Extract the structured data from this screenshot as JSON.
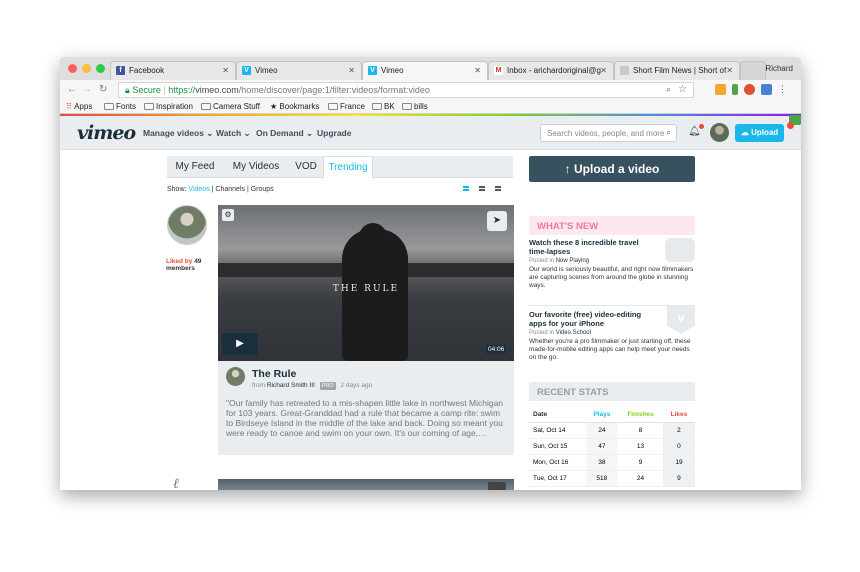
{
  "browser": {
    "tabs": [
      {
        "label": "Facebook",
        "favicon": "facebook-icon",
        "color": "#3b5998",
        "glyph": "f"
      },
      {
        "label": "Vimeo",
        "favicon": "vimeo-icon",
        "color": "#1ab7ea",
        "glyph": "V"
      },
      {
        "label": "Vimeo",
        "favicon": "vimeo-icon",
        "color": "#1ab7ea",
        "glyph": "V"
      },
      {
        "label": "Inbox - arichardoriginal@g",
        "favicon": "gmail-icon",
        "color": "#d93025",
        "glyph": "M"
      },
      {
        "label": "Short Film News | Short of",
        "favicon": "page-icon",
        "color": "#c9c9c9",
        "glyph": ""
      }
    ],
    "profile_name": "Richard",
    "secure_label": "Secure",
    "url_scheme": "https://",
    "url_host": "vimeo.com",
    "url_path": "/home/discover/page:1/filter:videos/format:video",
    "bookmarks": [
      "Apps",
      "Fonts",
      "Inspiration",
      "Camera Stuff",
      "Bookmarks",
      "France",
      "BK",
      "bills"
    ]
  },
  "vimeo": {
    "logo": "vimeo",
    "nav": [
      "Manage videos ⌄",
      "Watch ⌄",
      "On Demand ⌄",
      "Upgrade"
    ],
    "search_placeholder": "Search videos, people, and more",
    "upload_label": "Upload",
    "accent_color": "#1ab7ea"
  },
  "feed": {
    "tabs": [
      "My Feed",
      "My Videos",
      "VOD",
      "Trending"
    ],
    "active_tab": "Trending",
    "show_label": "Show:",
    "show_options": [
      "Videos",
      "Channels",
      "Groups"
    ],
    "liked_by_prefix": "Liked by",
    "liked_by_count": "49",
    "liked_by_suffix": "members",
    "video": {
      "thumb_text": "THE RULE",
      "duration": "04:06",
      "title": "The Rule",
      "from_label": "from",
      "author": "Richard Smith III",
      "badge": "PRO",
      "age": "2 days ago",
      "description": "\"Our family has retreated to a mis-shapen little lake in northwest Michigan for 103 years. Great-Granddad had a rule that became a camp rite: swim to Birdseye Island in the middle of the lake and back. Doing so meant you were ready to canoe and swim on your own. It's our coming of age,…"
    }
  },
  "sidebar": {
    "upload_video": "↑ Upload a video",
    "whats_new_title": "WHAT'S NEW",
    "news": [
      {
        "title": "Watch these 8 incredible travel time-lapses",
        "posted_in_label": "Posted in",
        "category": "Now Playing",
        "desc": "Our world is seriously beautiful, and right now filmmakers are capturing scenes from around the globe in stunning ways."
      },
      {
        "title": "Our favorite (free) video-editing apps for your iPhone",
        "posted_in_label": "Posted in",
        "category": "Video School",
        "desc": "Whether you're a pro filmmaker or just starting off, these made-for-mobile editing apps can help meet your needs on the go."
      }
    ],
    "recent_stats_title": "RECENT STATS",
    "stats": {
      "headers": [
        "Date",
        "Plays",
        "Finishes",
        "Likes"
      ],
      "header_colors": [
        "#1a2e3b",
        "#1ab7ea",
        "#7ed321",
        "#e74c3c"
      ],
      "rows": [
        [
          "Sat, Oct 14",
          "24",
          "8",
          "2"
        ],
        [
          "Sun, Oct 15",
          "47",
          "13",
          "0"
        ],
        [
          "Mon, Oct 16",
          "38",
          "9",
          "19"
        ],
        [
          "Tue, Oct 17",
          "518",
          "24",
          "9"
        ]
      ]
    }
  }
}
